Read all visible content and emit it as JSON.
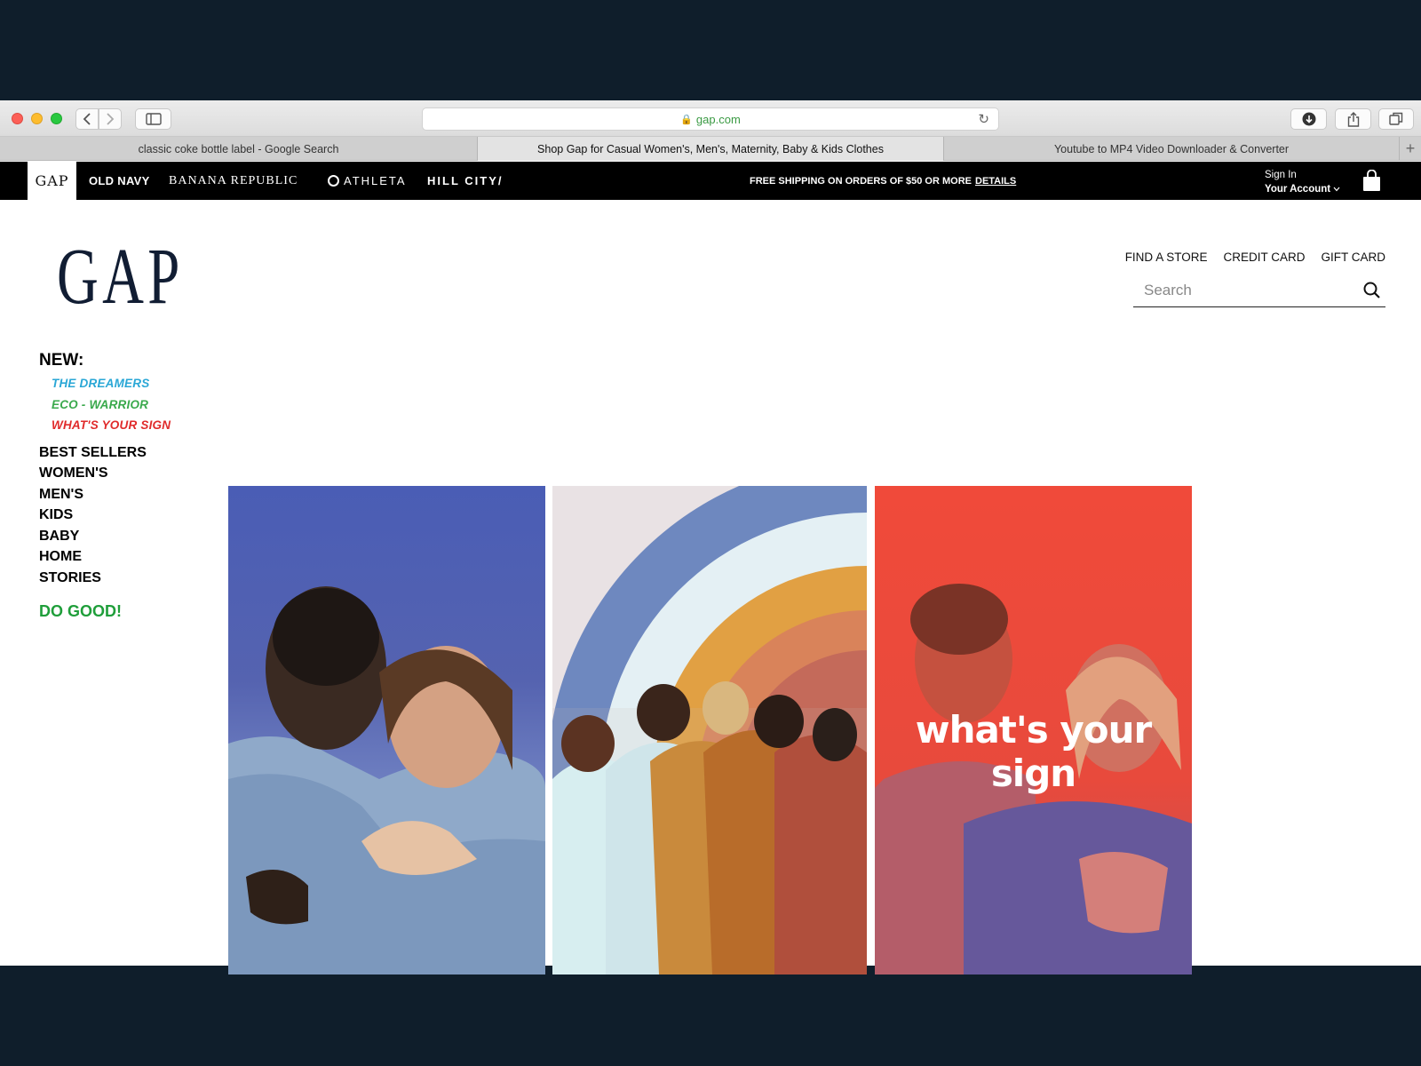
{
  "browser": {
    "url": "gap.com",
    "tabs": [
      {
        "label": "classic coke bottle label - Google Search"
      },
      {
        "label": "Shop Gap for Casual Women's, Men's, Maternity, Baby & Kids Clothes"
      },
      {
        "label": "Youtube to MP4 Video Downloader & Converter"
      }
    ],
    "new_tab": "+"
  },
  "brandbar": {
    "brands": {
      "gap": "GAP",
      "old_navy": "OLD NAVY",
      "banana_republic": "BANANA REPUBLIC",
      "athleta": "ATHLETA",
      "hill_city": "HILL CITY/"
    },
    "shipping": "FREE SHIPPING ON ORDERS OF $50 OR MORE",
    "shipping_link": "DETAILS",
    "sign_in": "Sign In",
    "account": "Your Account"
  },
  "header": {
    "logo": "GAP",
    "links": {
      "find_store": "FIND A STORE",
      "credit_card": "CREDIT CARD",
      "gift_card": "GIFT CARD"
    },
    "search_placeholder": "Search"
  },
  "sidenav": {
    "new_label": "NEW:",
    "sub": {
      "dreamers": "THE DREAMERS",
      "eco": "ECO - WARRIOR",
      "sign": "WHAT'S YOUR SIGN"
    },
    "items": {
      "best_sellers": "BEST SELLERS",
      "womens": "WOMEN'S",
      "mens": "MEN'S",
      "kids": "KIDS",
      "baby": "BABY",
      "home": "HOME",
      "stories": "STORIES"
    },
    "do_good": "DO GOOD!"
  },
  "panels": {
    "sign_text": "what's your sign"
  },
  "colors": {
    "page_bg": "#0f1e2b",
    "dreamers": "#2aa7d6",
    "eco": "#3aa94c",
    "sign": "#e02b2b",
    "do_good": "#1f9e3a"
  }
}
